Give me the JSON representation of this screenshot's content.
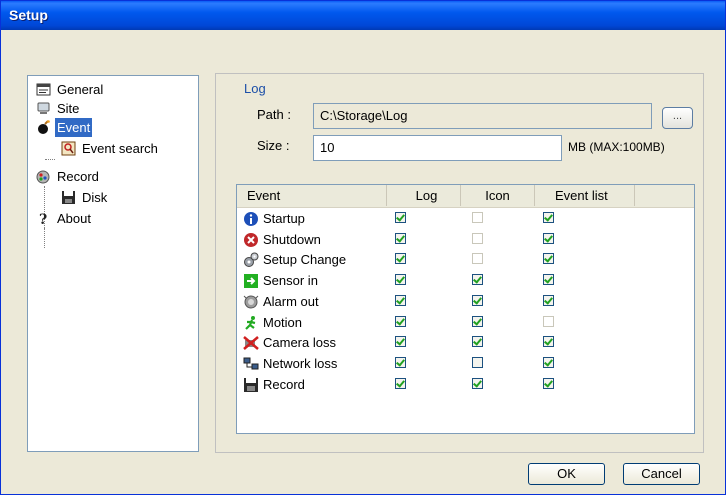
{
  "window": {
    "title": "Setup"
  },
  "tree": {
    "items": [
      {
        "label": "General",
        "icon": "general-icon"
      },
      {
        "label": "Site",
        "icon": "site-icon"
      },
      {
        "label": "Event",
        "icon": "event-icon",
        "selected": true
      },
      {
        "label": "Event search",
        "icon": "event-search-icon"
      },
      {
        "label": "Record",
        "icon": "record-icon"
      },
      {
        "label": "Disk",
        "icon": "disk-icon"
      },
      {
        "label": "About",
        "icon": "about-icon"
      }
    ]
  },
  "log": {
    "group_title": "Log",
    "path_label": "Path :",
    "path_value": "C:\\Storage\\Log",
    "browse_label": "...",
    "size_label": "Size :",
    "size_value": "10",
    "size_unit": "MB  (MAX:100MB)"
  },
  "events": {
    "columns": [
      "Event",
      "Log",
      "Icon",
      "Event list"
    ],
    "rows": [
      {
        "name": "Startup",
        "icon": "info-icon",
        "log": true,
        "icon_cb": false,
        "icon_disabled": true,
        "event_list": true
      },
      {
        "name": "Shutdown",
        "icon": "shutdown-icon",
        "log": true,
        "icon_cb": false,
        "icon_disabled": true,
        "event_list": true
      },
      {
        "name": "Setup Change",
        "icon": "gears-icon",
        "log": true,
        "icon_cb": false,
        "icon_disabled": true,
        "event_list": true
      },
      {
        "name": "Sensor in",
        "icon": "sensor-in-icon",
        "log": true,
        "icon_cb": true,
        "event_list": true
      },
      {
        "name": "Alarm out",
        "icon": "alarm-out-icon",
        "log": true,
        "icon_cb": true,
        "event_list": true
      },
      {
        "name": "Motion",
        "icon": "motion-icon",
        "log": true,
        "icon_cb": true,
        "event_list": false
      },
      {
        "name": "Camera loss",
        "icon": "camera-loss-icon",
        "log": true,
        "icon_cb": true,
        "event_list": true
      },
      {
        "name": "Network loss",
        "icon": "network-loss-icon",
        "log": true,
        "icon_cb": false,
        "event_list": true
      },
      {
        "name": "Record",
        "icon": "record-disk-icon",
        "log": true,
        "icon_cb": true,
        "event_list": true
      }
    ]
  },
  "buttons": {
    "ok": "OK",
    "cancel": "Cancel"
  }
}
